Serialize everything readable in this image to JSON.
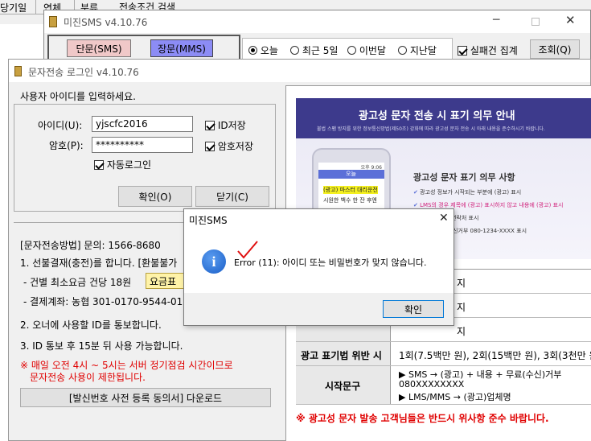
{
  "back_window": {
    "header_cols": [
      "당기일",
      "연체",
      "분류"
    ],
    "group_label": "전송조건 검색"
  },
  "sms_window": {
    "title": "미진SMS v4.10.76",
    "tab_sms": "단문(SMS)",
    "tab_mms": "장문(MMS)",
    "radios": [
      "오늘",
      "최근 5일",
      "이번달",
      "지난달"
    ],
    "fail_check": "실패건 집계",
    "query_button": "조회(Q)"
  },
  "login_window": {
    "title": "문자전송 로그인  v4.10.76",
    "prompt": "사용자 아이디를 입력하세요.",
    "id_label": "아이디(U):",
    "id_value": "yjscfc2016",
    "pw_label": "암호(P):",
    "pw_value": "**********",
    "save_id": "ID저장",
    "save_pw": "암호저장",
    "auto_login": "자동로그인",
    "ok_button": "확인(O)",
    "close_button": "닫기(C)",
    "method_title": "[문자전송방법]   문의: 1566-8680",
    "step1": "1. 선불결재(충전)를 합니다. [환불불가",
    "fee_line": "- 건별 최소요금 건당 18원",
    "fee_button": "요금표",
    "account_line": "- 결제계좌: 농협 301-0170-9544-01 진",
    "step2": "2. 오너에 사용할 ID를 통보합니다.",
    "step3": "3. ID 통보 후 15분 뒤 사용 가능합니다.",
    "warning1": "※ 매일 오전 4시 ~ 5시는 서버 정기점검 시간이므로",
    "warning2": "문자전송 사용이 제한됩니다.",
    "download_button": "[발신번호 사전 등록 동의서] 다운로드"
  },
  "notice": {
    "banner_title": "광고성 문자 전송 시 표기 의무 안내",
    "banner_sub": "불법 스팸 방지를 위한 정보통신망법(제50조) 강화에 따라 광고성 문자 전송 시 아래 내용을 준수하시기 바랍니다.",
    "phone_tab": "오늘",
    "phone_status": "오후 9:06",
    "phone_msg1": "(광고) 마스터 대리운전",
    "phone_msg2": "시원한 백수 한 잔 후엔",
    "heading": "광고성 문자 표기 의무 사항",
    "bullets": [
      "광고성 정보가 시작되는 부분에 (광고) 표시",
      "LMS의 경우 제목에 (광고) 표시하지 않고 내용에 (광고) 표시",
      "송자의 명칭, 연락처 표시",
      "부분에 무료수신거부 080-1234-XXXX 표시"
    ],
    "table_rows": [
      {
        "label": "",
        "value": "지"
      },
      {
        "label": "",
        "value": "지"
      },
      {
        "label": "",
        "value": "지"
      },
      {
        "label": "광고 표기법 위반 시",
        "value": "1회(7.5백만 원), 2회(15백만 원), 3회(3천만 원)"
      }
    ],
    "start_label": "시작문구",
    "start_lines": [
      "▶ SMS → (광고) + 내용 + 무료(수신)거부",
      "080XXXXXXXX",
      "▶ LMS/MMS → (광고)업체명"
    ],
    "footer": "※ 광고성 문자 발송 고객님들은 반드시 위사항 준수 바랍니다."
  },
  "dialog": {
    "title": "미진SMS",
    "message": "Error (11): 아이디 또는 비밀번호가 맞지 않습니다.",
    "ok_button": "확인"
  },
  "colors": {
    "mms_tab": "#8080ff",
    "sms_tab": "#f0c0c0",
    "banner": "#3d3a8c",
    "warning": "#e00000",
    "info_icon": "#1a5fc8"
  }
}
